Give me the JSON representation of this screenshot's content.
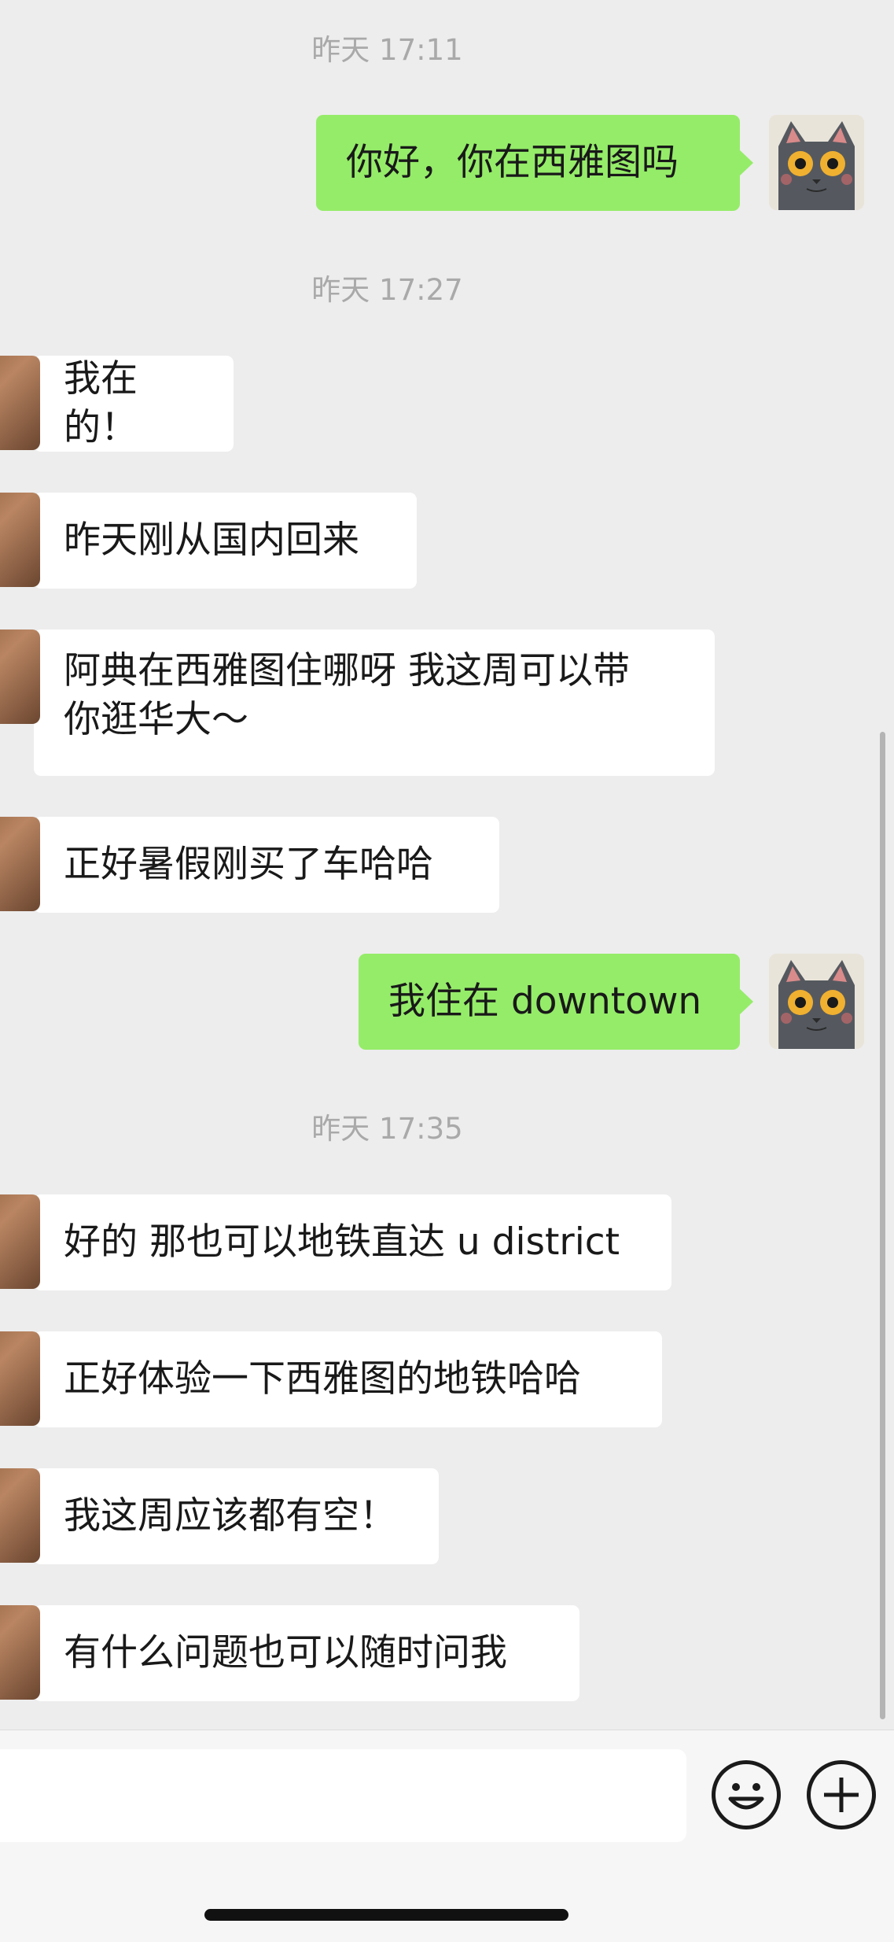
{
  "chat": {
    "timestamps": [
      "昨天 17:11",
      "昨天 17:27",
      "昨天 17:35"
    ],
    "messages": [
      {
        "from": "me",
        "text": "你好，你在西雅图吗"
      },
      {
        "from": "them",
        "text": "我在的！"
      },
      {
        "from": "them",
        "text": "昨天刚从国内回来"
      },
      {
        "from": "them",
        "text": "阿典在西雅图住哪呀 我这周可以带你逛华大～",
        "line1": "阿典在西雅图住哪呀 我这周可以带",
        "line2": "你逛华大～"
      },
      {
        "from": "them",
        "text": "正好暑假刚买了车哈哈"
      },
      {
        "from": "me",
        "text": "我住在 downtown"
      },
      {
        "from": "them",
        "text": "好的 那也可以地铁直达 u district"
      },
      {
        "from": "them",
        "text": "正好体验一下西雅图的地铁哈哈"
      },
      {
        "from": "them",
        "text": "我这周应该都有空！"
      },
      {
        "from": "them",
        "text": "有什么问题也可以随时问我"
      }
    ]
  },
  "input_bar": {
    "icons": [
      "emoji-icon",
      "plus-icon"
    ]
  },
  "colors": {
    "background": "#ededed",
    "my_bubble": "#95ec69",
    "their_bubble": "#ffffff",
    "timestamp_text": "#a9a9a9"
  }
}
